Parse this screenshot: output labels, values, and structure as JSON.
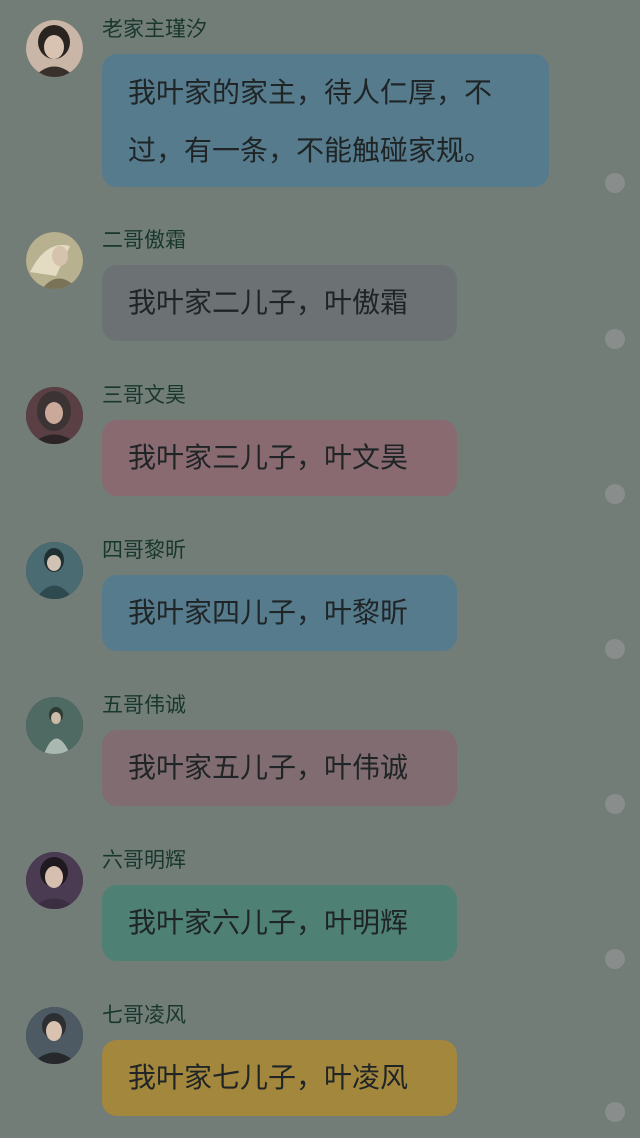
{
  "colors": {
    "background": "#737d78",
    "name_text": "#18372d",
    "bubble_text": "#1f2426",
    "status_dot": "#898d8b"
  },
  "messages": [
    {
      "sender": "老家主瑾汐",
      "text": "我叶家的家主，待人仁厚，不过，有一条，不能触碰家规。",
      "bubble_color": "#567b8c",
      "avatar_icon": "woman-portrait-avatar",
      "avatar_colors": [
        "#d8c3b3",
        "#2a2420",
        "#c9b6a6"
      ]
    },
    {
      "sender": "二哥傲霜",
      "text": "我叶家二儿子，叶傲霜",
      "bubble_color": "#6c7274",
      "avatar_icon": "man-with-fan-avatar",
      "avatar_colors": [
        "#b8b190",
        "#e3dcc2",
        "#7a7357"
      ]
    },
    {
      "sender": "三哥文昊",
      "text": "我叶家三儿子，叶文昊",
      "bubble_color": "#8a6a71",
      "avatar_icon": "man-long-hair-avatar",
      "avatar_colors": [
        "#3b3334",
        "#caa99a",
        "#5a3f44"
      ]
    },
    {
      "sender": "四哥黎昕",
      "text": "我叶家四儿子，叶黎昕",
      "bubble_color": "#567b8c",
      "avatar_icon": "man-teal-robe-avatar",
      "avatar_colors": [
        "#4a6b72",
        "#d0c2b4",
        "#1f3033"
      ]
    },
    {
      "sender": "五哥伟诚",
      "text": "我叶家五儿子，叶伟诚",
      "bubble_color": "#816d71",
      "avatar_icon": "man-in-forest-avatar",
      "avatar_colors": [
        "#4f6a62",
        "#a9b8b0",
        "#2d3b35"
      ]
    },
    {
      "sender": "六哥明辉",
      "text": "我叶家六儿子，叶明辉",
      "bubble_color": "#4f8074",
      "avatar_icon": "man-purple-robe-avatar",
      "avatar_colors": [
        "#4a3a52",
        "#d7bfb0",
        "#1e1a20"
      ]
    },
    {
      "sender": "七哥凌风",
      "text": "我叶家七儿子，叶凌风",
      "bubble_color": "#a3873c",
      "avatar_icon": "man-dark-robe-avatar",
      "avatar_colors": [
        "#2d2f33",
        "#d9c2b0",
        "#4d5a63"
      ]
    }
  ]
}
